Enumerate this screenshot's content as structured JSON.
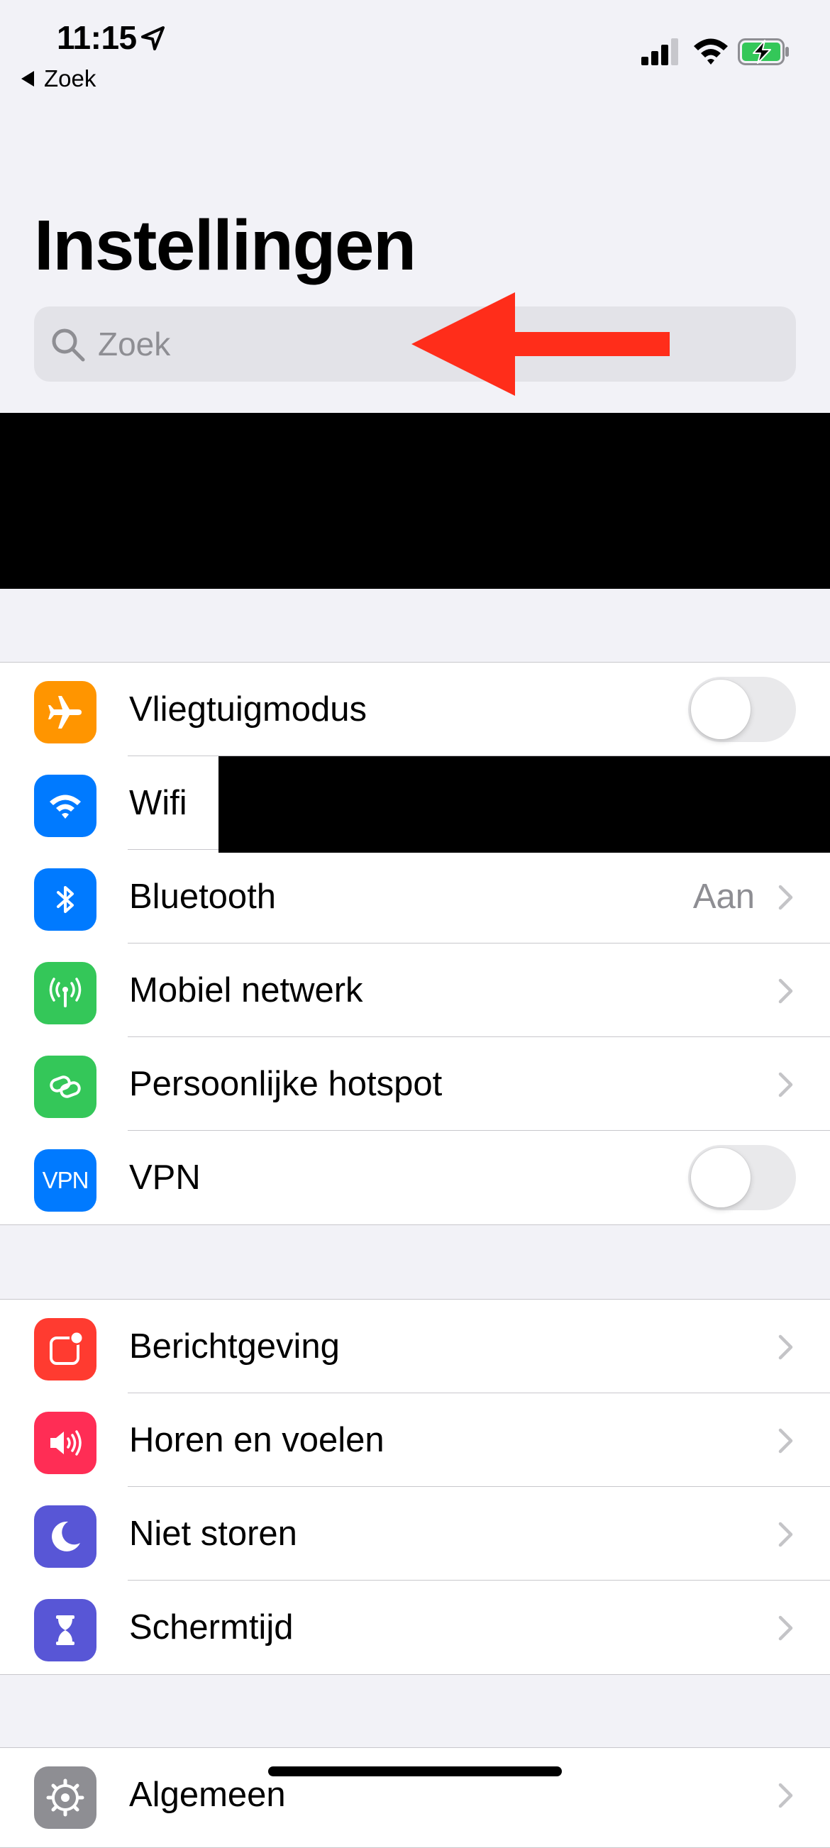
{
  "status_bar": {
    "time": "11:15",
    "back_label": "Zoek"
  },
  "header": {
    "title": "Instellingen"
  },
  "search": {
    "placeholder": "Zoek"
  },
  "colors": {
    "airplane": "#ff9500",
    "blue": "#007aff",
    "green": "#34c759",
    "red": "#ff3b30",
    "pink": "#ff2d55",
    "indigo": "#5856d6",
    "gray": "#8e8e93",
    "annotation_arrow": "#ff2d1a"
  },
  "groups": [
    {
      "items": [
        {
          "label": "Vliegtuigmodus",
          "icon": "airplane-icon",
          "control": "toggle",
          "state": false
        },
        {
          "label": "Wifi",
          "icon": "wifi-icon",
          "control": "redacted"
        },
        {
          "label": "Bluetooth",
          "icon": "bluetooth-icon",
          "value": "Aan",
          "control": "chevron"
        },
        {
          "label": "Mobiel netwerk",
          "icon": "antenna-icon",
          "control": "chevron"
        },
        {
          "label": "Persoonlijke hotspot",
          "icon": "hotspot-icon",
          "control": "chevron"
        },
        {
          "label": "VPN",
          "icon": "vpn-icon",
          "icon_text": "VPN",
          "control": "toggle",
          "state": false
        }
      ]
    },
    {
      "items": [
        {
          "label": "Berichtgeving",
          "icon": "notifications-icon",
          "control": "chevron"
        },
        {
          "label": "Horen en voelen",
          "icon": "speaker-icon",
          "control": "chevron"
        },
        {
          "label": "Niet storen",
          "icon": "moon-icon",
          "control": "chevron"
        },
        {
          "label": "Schermtijd",
          "icon": "hourglass-icon",
          "control": "chevron"
        }
      ]
    },
    {
      "items": [
        {
          "label": "Algemeen",
          "icon": "gear-icon",
          "control": "chevron"
        }
      ]
    }
  ]
}
